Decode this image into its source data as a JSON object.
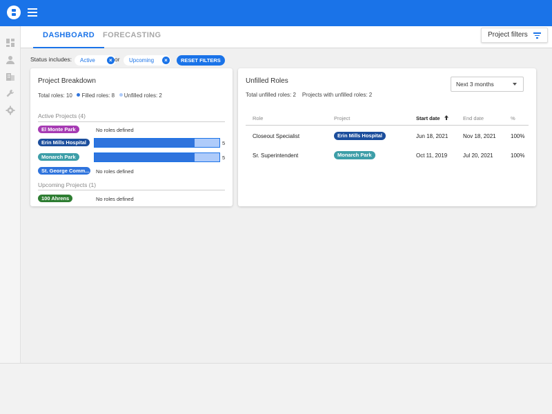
{
  "colors": {
    "primary": "#1a73e8",
    "el_monte": "#a63bb3",
    "erin_mills": "#1c4e9c",
    "monarch": "#3d9ea8",
    "st_george": "#2f74dd",
    "ahrens": "#2e7d32"
  },
  "header": {
    "logo_icon": "logo-icon",
    "menu_icon": "hamburger-icon"
  },
  "sidebar": {
    "icons": [
      "dashboard-icon",
      "person-icon",
      "building-icon",
      "wrench-icon",
      "gear-icon"
    ]
  },
  "tabs": [
    {
      "label": "DASHBOARD",
      "active": true
    },
    {
      "label": "FORECASTING",
      "active": false
    }
  ],
  "project_filters": {
    "label": "Project filters",
    "icon": "filter-list-icon"
  },
  "filters": {
    "status_label": "Status includes:",
    "chip_active": "Active",
    "or": "or",
    "chip_upcoming": "Upcoming",
    "reset_label": "RESET FILTERS"
  },
  "project_breakdown": {
    "title": "Project Breakdown",
    "total_roles": "Total roles: 10",
    "filled_roles": "Filled roles: 8",
    "unfilled_roles": "Unfilled roles: 2",
    "active_header": "Active Projects (4)",
    "upcoming_header": "Upcoming Projects (1)",
    "active_projects": [
      {
        "name": "El Monte Park",
        "note": "No roles defined"
      },
      {
        "name": "Erin Mills Hospital",
        "count": "5",
        "filled_fraction": 0.8
      },
      {
        "name": "Monarch Park",
        "count": "5",
        "filled_fraction": 0.8
      },
      {
        "name": "St. George Comm...",
        "note": "No roles defined"
      }
    ],
    "upcoming_projects": [
      {
        "name": "100 Ahrens",
        "note": "No roles defined"
      }
    ]
  },
  "unfilled_roles": {
    "title": "Unfilled Roles",
    "total": "Total unfilled roles: 2",
    "projects_with": "Projects with unfilled roles: 2",
    "range_select": "Next 3 months",
    "columns": {
      "role": "Role",
      "project": "Project",
      "start": "Start date",
      "end": "End date",
      "pct": "%"
    },
    "rows": [
      {
        "role": "Closeout Specialist",
        "project": "Erin Mills Hospital",
        "start": "Jun 18, 2021",
        "end": "Nov 18, 2021",
        "pct": "100%"
      },
      {
        "role": "Sr. Superintendent",
        "project": "Monarch Park",
        "start": "Oct 11, 2019",
        "end": "Jul 20, 2021",
        "pct": "100%"
      }
    ]
  }
}
